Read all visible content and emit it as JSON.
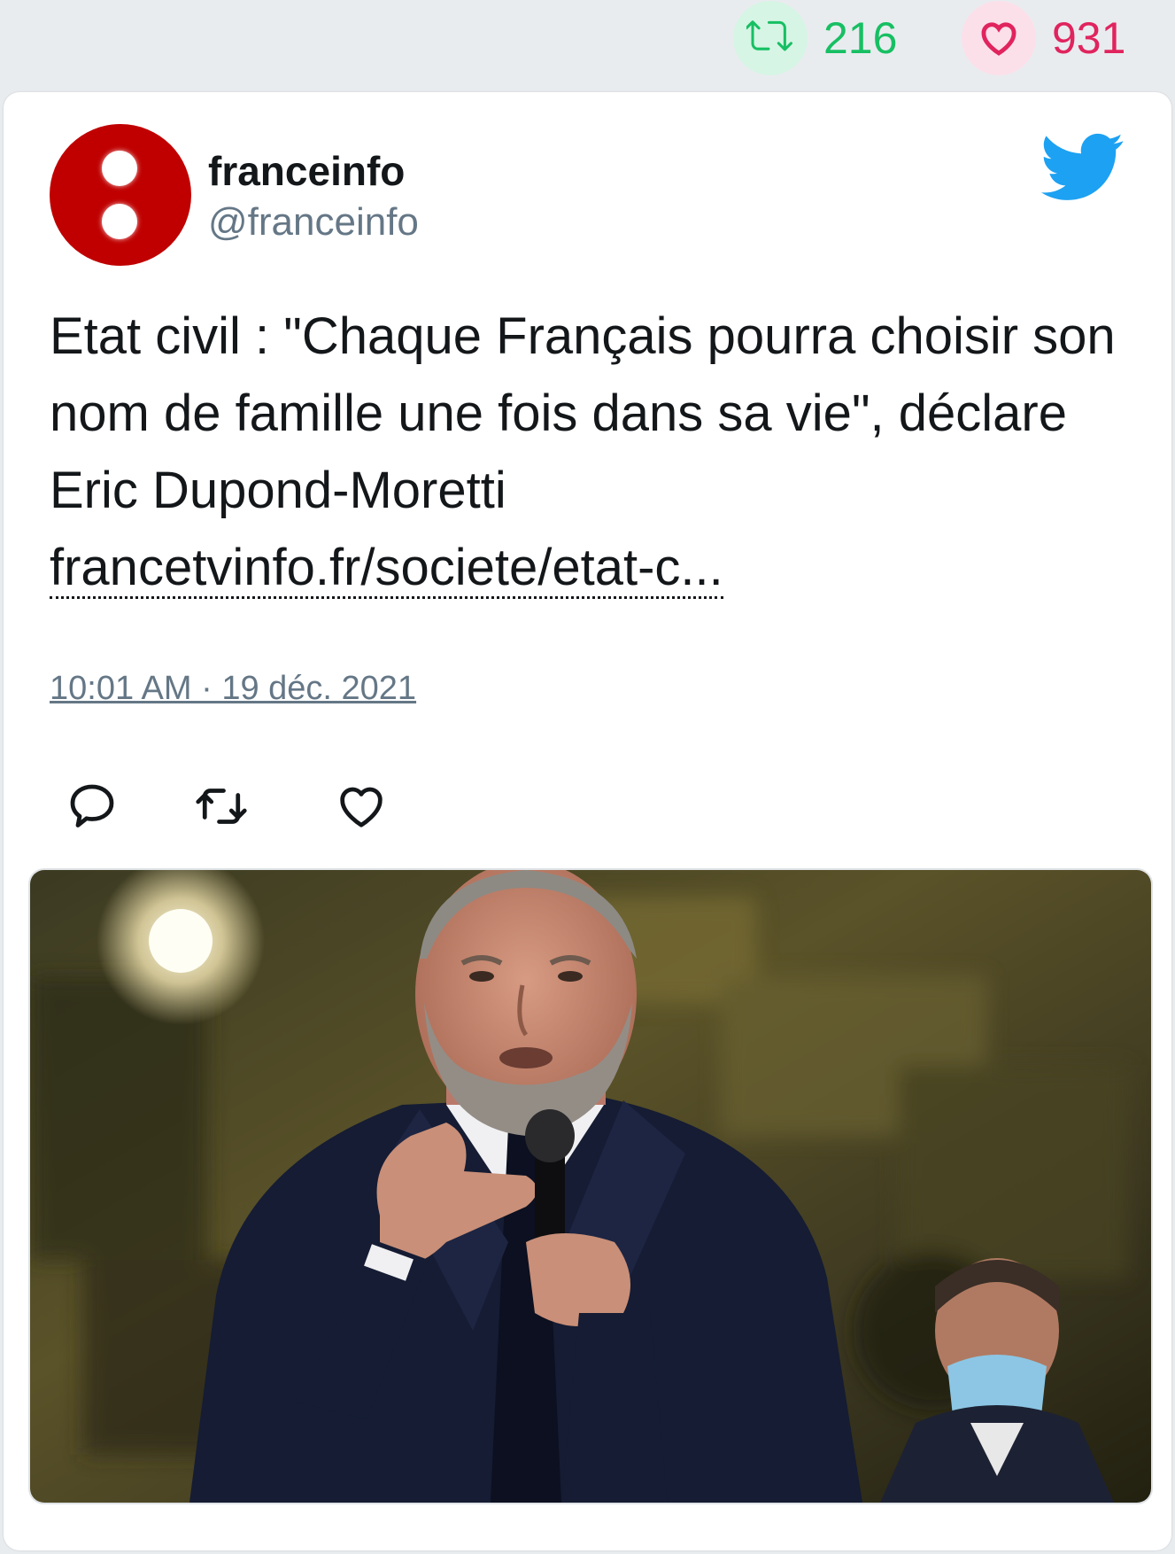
{
  "stats": {
    "retweets": "216",
    "likes": "931",
    "retweet_icon": "retweet-icon",
    "like_icon": "heart-icon"
  },
  "tweet": {
    "author_name": "franceinfo",
    "author_handle": "@franceinfo",
    "text": "Etat civil : \"Chaque Français pourra choisir son nom de famille une fois dans sa vie\", déclare Eric Dupond-Moretti",
    "link": "francetvinfo.fr/societe/etat-c...",
    "timestamp": "10:01 AM · 19 déc. 2021",
    "actions": [
      "reply-icon",
      "retweet-icon",
      "like-icon"
    ]
  },
  "colors": {
    "retweet": "#17bf63",
    "like": "#e0245e",
    "twitter_blue": "#1da1f2",
    "avatar_red": "#c00000",
    "muted": "#657786"
  }
}
